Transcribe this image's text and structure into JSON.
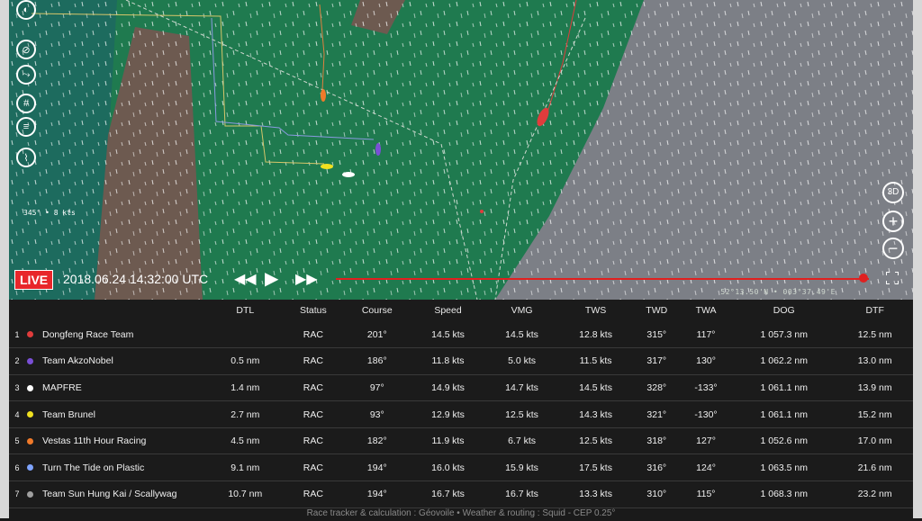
{
  "playback": {
    "live_label": "LIVE",
    "datetime": "2018.06.24 14:32:00 UTC",
    "progress": 0.99
  },
  "map": {
    "wind_readout": "345° • 8 kts",
    "coordinates": "52°13.50'N • 003°37.49'E",
    "zoom": {
      "btn_3d": "3D",
      "zoom_in": "+",
      "zoom_out": "−"
    },
    "tools": [
      "compass-icon",
      "no-sail-icon",
      "route-icon",
      "grid-icon",
      "layers-icon",
      "graph-icon"
    ]
  },
  "colors": {
    "live": "#e8262a",
    "sea_green": "#1f7a4f",
    "land": "#6d5a50",
    "storm_gray": "#7c7f86"
  },
  "table": {
    "headers": [
      "DTL",
      "Status",
      "Course",
      "Speed",
      "VMG",
      "TWS",
      "TWD",
      "TWA",
      "DOG",
      "DTF"
    ],
    "rows": [
      {
        "rank": "1",
        "team": "Dongfeng Race Team",
        "color": "#e03c3c",
        "cells": [
          "",
          "RAC",
          "201°",
          "14.5 kts",
          "14.5 kts",
          "12.8 kts",
          "315°",
          "117°",
          "1 057.3 nm",
          "12.5 nm"
        ]
      },
      {
        "rank": "2",
        "team": "Team AkzoNobel",
        "color": "#7a4fd6",
        "cells": [
          "0.5 nm",
          "RAC",
          "186°",
          "11.8 kts",
          "5.0 kts",
          "11.5 kts",
          "317°",
          "130°",
          "1 062.2 nm",
          "13.0 nm"
        ]
      },
      {
        "rank": "3",
        "team": "MAPFRE",
        "color": "#ffffff",
        "cells": [
          "1.4 nm",
          "RAC",
          "97°",
          "14.9 kts",
          "14.7 kts",
          "14.5 kts",
          "328°",
          "-133°",
          "1 061.1 nm",
          "13.9 nm"
        ]
      },
      {
        "rank": "4",
        "team": "Team Brunel",
        "color": "#f0e020",
        "cells": [
          "2.7 nm",
          "RAC",
          "93°",
          "12.9 kts",
          "12.5 kts",
          "14.3 kts",
          "321°",
          "-130°",
          "1 061.1 nm",
          "15.2 nm"
        ]
      },
      {
        "rank": "5",
        "team": "Vestas 11th Hour Racing",
        "color": "#f07a2a",
        "cells": [
          "4.5 nm",
          "RAC",
          "182°",
          "11.9 kts",
          "6.7 kts",
          "12.5 kts",
          "318°",
          "127°",
          "1 052.6 nm",
          "17.0 nm"
        ]
      },
      {
        "rank": "6",
        "team": "Turn The Tide on Plastic",
        "color": "#7fa4ff",
        "cells": [
          "9.1 nm",
          "RAC",
          "194°",
          "16.0 kts",
          "15.9 kts",
          "17.5 kts",
          "316°",
          "124°",
          "1 063.5 nm",
          "21.6 nm"
        ]
      },
      {
        "rank": "7",
        "team": "Team Sun Hung Kai / Scallywag",
        "color": "#a0a0a0",
        "cells": [
          "10.7 nm",
          "RAC",
          "194°",
          "16.7 kts",
          "16.7 kts",
          "13.3 kts",
          "310°",
          "115°",
          "1 068.3 nm",
          "23.2 nm"
        ]
      }
    ]
  },
  "footer": "Race tracker & calculation : Géovoile • Weather & routing : Squid - CEP 0.25°"
}
